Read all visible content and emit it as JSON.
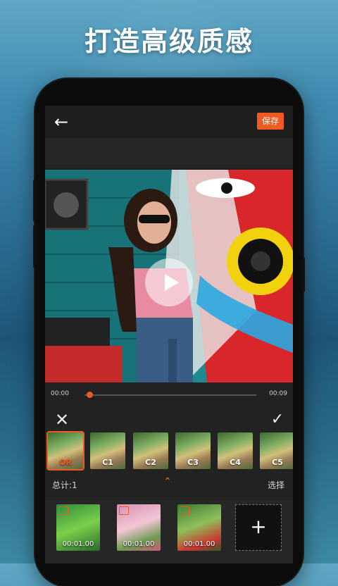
{
  "headline": "打造高级质感",
  "header": {
    "back_icon": "arrow-left-icon",
    "save_label": "保存"
  },
  "player": {
    "time_start": "00:00",
    "time_end": "00:09",
    "progress": 0.03
  },
  "filters": [
    {
      "label": "OR",
      "selected": true
    },
    {
      "label": "C1",
      "selected": false
    },
    {
      "label": "C2",
      "selected": false
    },
    {
      "label": "C3",
      "selected": false
    },
    {
      "label": "C4",
      "selected": false
    },
    {
      "label": "C5",
      "selected": false
    }
  ],
  "summary": {
    "total": "总计:1",
    "select_label": "选择"
  },
  "clips": [
    {
      "duration": "00:01.00"
    },
    {
      "duration": "00:01.00"
    },
    {
      "duration": "00:01.00"
    }
  ],
  "colors": {
    "accent": "#f05a22"
  }
}
